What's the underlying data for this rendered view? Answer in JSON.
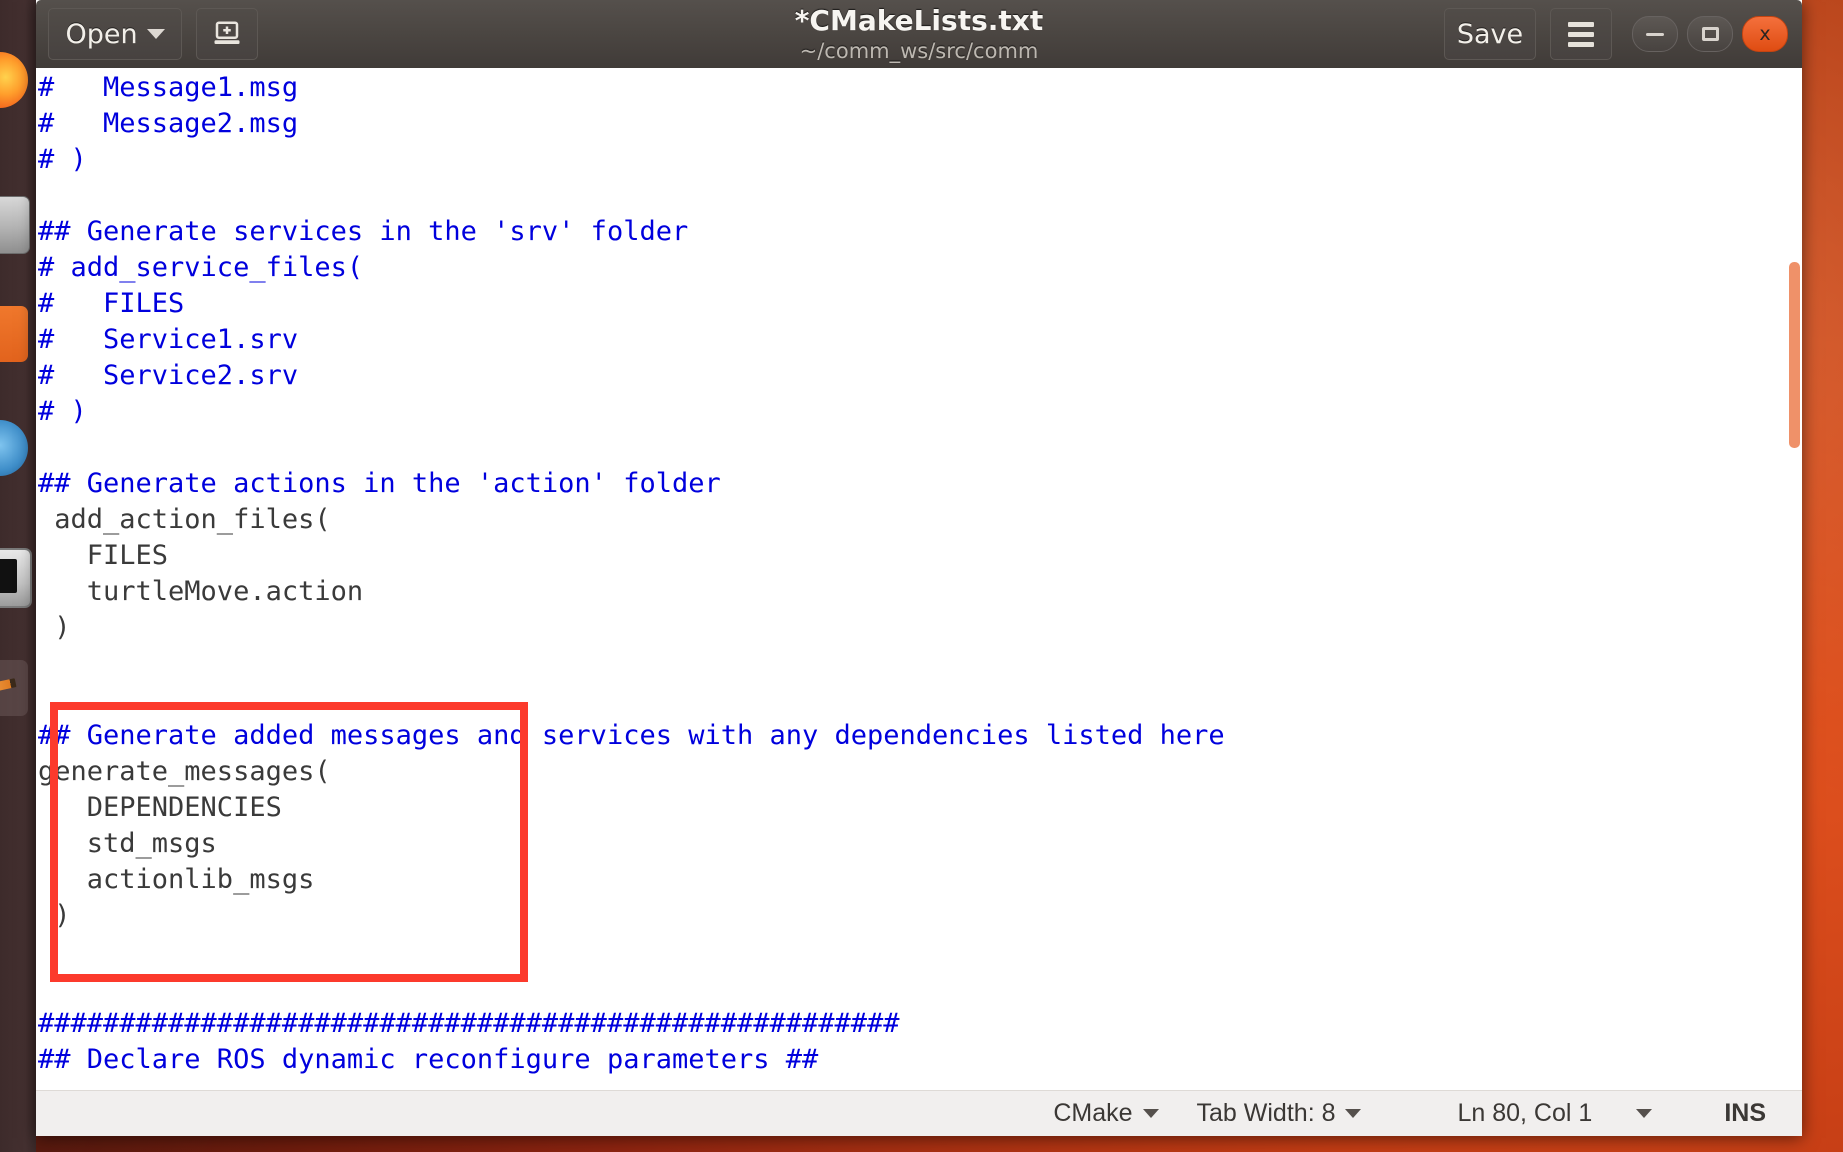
{
  "window": {
    "title": "*CMakeLists.txt",
    "path": "~/comm_ws/src/comm",
    "controls": {
      "minimize_label": "minimize",
      "maximize_label": "maximize",
      "close_label": "x"
    }
  },
  "toolbar": {
    "open_label": "Open",
    "new_document_label": "New Document",
    "save_label": "Save",
    "menu_label": "Main menu"
  },
  "editor": {
    "lines": [
      {
        "text": "#   Message1.msg",
        "comment": true
      },
      {
        "text": "#   Message2.msg",
        "comment": true
      },
      {
        "text": "# )",
        "comment": true
      },
      {
        "text": "",
        "comment": false
      },
      {
        "text": "## Generate services in the 'srv' folder",
        "comment": true
      },
      {
        "text": "# add_service_files(",
        "comment": true
      },
      {
        "text": "#   FILES",
        "comment": true
      },
      {
        "text": "#   Service1.srv",
        "comment": true
      },
      {
        "text": "#   Service2.srv",
        "comment": true
      },
      {
        "text": "# )",
        "comment": true
      },
      {
        "text": "",
        "comment": false
      },
      {
        "text": "## Generate actions in the 'action' folder",
        "comment": true
      },
      {
        "text": " add_action_files(",
        "comment": false
      },
      {
        "text": "   FILES",
        "comment": false
      },
      {
        "text": "   turtleMove.action",
        "comment": false
      },
      {
        "text": " )",
        "comment": false
      },
      {
        "text": "",
        "comment": false
      },
      {
        "text": "",
        "comment": false
      },
      {
        "text": "## Generate added messages and services with any dependencies listed here",
        "comment": true
      },
      {
        "text": "generate_messages(",
        "comment": false
      },
      {
        "text": "   DEPENDENCIES",
        "comment": false
      },
      {
        "text": "   std_msgs",
        "comment": false
      },
      {
        "text": "   actionlib_msgs",
        "comment": false
      },
      {
        "text": " )",
        "comment": false
      },
      {
        "text": "",
        "comment": false
      },
      {
        "text": "",
        "comment": false
      },
      {
        "text": "#####################################################",
        "comment": true
      },
      {
        "text": "## Declare ROS dynamic reconfigure parameters ##",
        "comment": true
      }
    ]
  },
  "statusbar": {
    "language": "CMake",
    "tab_width": "Tab Width: 8",
    "cursor_position": "Ln 80, Col 1",
    "insert_mode": "INS"
  },
  "annotation": {
    "type": "red-rectangle-highlight",
    "color": "#fc3a2c"
  },
  "colors": {
    "comment_blue": "#0000dd",
    "code_gray": "#3a3a3a",
    "accent_orange": "#ef9169",
    "titlebar": "#4b4642",
    "statusbar_bg": "#f1efee"
  },
  "launcher": {
    "items": [
      {
        "name": "firefox"
      },
      {
        "name": "files"
      },
      {
        "name": "software-center"
      },
      {
        "name": "help"
      },
      {
        "name": "terminal"
      },
      {
        "name": "text-editor"
      }
    ]
  }
}
